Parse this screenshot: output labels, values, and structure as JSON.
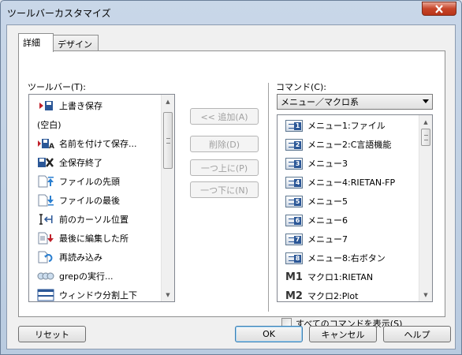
{
  "window": {
    "title": "ツールバーカスタマイズ"
  },
  "tabs": [
    {
      "label": "詳細"
    },
    {
      "label": "デザイン"
    }
  ],
  "toolbar_list": {
    "label": "ツールバー(T):",
    "items": [
      {
        "label": "上書き保存",
        "icon": "save-icon"
      },
      {
        "label": "(空白)",
        "icon": ""
      },
      {
        "label": "名前を付けて保存...",
        "icon": "save-as-icon"
      },
      {
        "label": "全保存終了",
        "icon": "save-all-exit-icon"
      },
      {
        "label": "ファイルの先頭",
        "icon": "file-top-icon"
      },
      {
        "label": "ファイルの最後",
        "icon": "file-bottom-icon"
      },
      {
        "label": "前のカーソル位置",
        "icon": "prev-cursor-icon"
      },
      {
        "label": "最後に編集した所",
        "icon": "last-edit-icon"
      },
      {
        "label": "再読み込み",
        "icon": "reload-icon"
      },
      {
        "label": "grepの実行...",
        "icon": "grep-icon"
      },
      {
        "label": "ウィンドウ分割上下",
        "icon": "split-window-icon"
      }
    ]
  },
  "middle_buttons": {
    "add": "<< 追加(A)",
    "delete": "削除(D)",
    "up": "一つ上に(P)",
    "down": "一つ下に(N)"
  },
  "command_list": {
    "label": "コマンド(C):",
    "category": "メニュー／マクロ系",
    "items": [
      {
        "label": "メニュー1:ファイル",
        "badge": "1"
      },
      {
        "label": "メニュー2:C言語機能",
        "badge": "2"
      },
      {
        "label": "メニュー3",
        "badge": "3"
      },
      {
        "label": "メニュー4:RIETAN-FP",
        "badge": "4"
      },
      {
        "label": "メニュー5",
        "badge": "5"
      },
      {
        "label": "メニュー6",
        "badge": "6"
      },
      {
        "label": "メニュー7",
        "badge": "7"
      },
      {
        "label": "メニュー8:右ボタン",
        "badge": "8"
      },
      {
        "label": "マクロ1:RIETAN",
        "badge": "M1"
      },
      {
        "label": "マクロ2:Plot",
        "badge": "M2"
      }
    ],
    "show_all_label": "すべてのコマンドを表示(S)"
  },
  "footer": {
    "reset": "リセット",
    "ok": "OK",
    "cancel": "キャンセル",
    "help": "ヘルプ"
  }
}
